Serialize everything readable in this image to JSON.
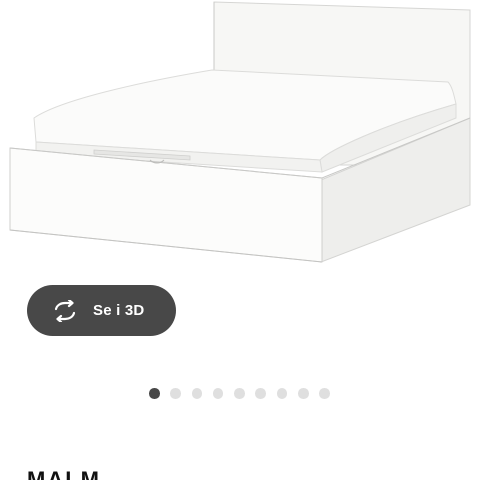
{
  "product": {
    "name": "MALM",
    "image_alt": "bed-with-storage-white"
  },
  "view_3d": {
    "label": "Se i 3D",
    "icon": "rotate-3d-icon"
  },
  "carousel": {
    "total_images": 9,
    "active_index": 0
  },
  "colors": {
    "button_background": "#484848",
    "dot_active": "#484848",
    "dot_inactive": "#dfdfdf"
  }
}
